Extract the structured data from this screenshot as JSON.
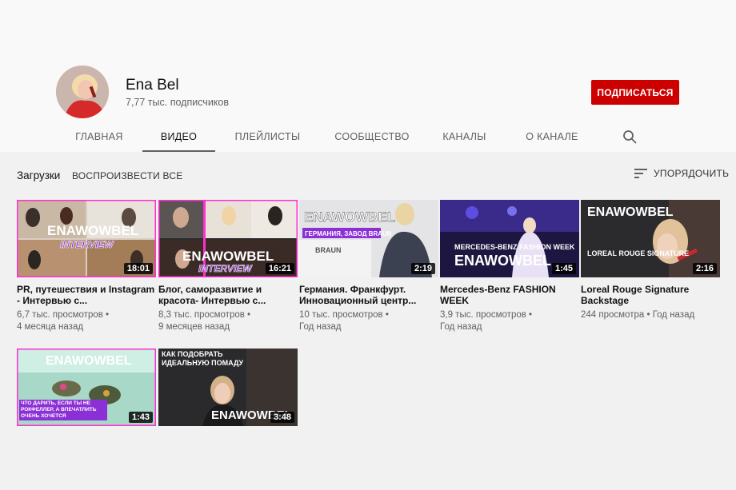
{
  "channel": {
    "name": "Ena Bel",
    "subscribers": "7,77 тыс. подписчиков",
    "subscribe_label": "ПОДПИСАТЬСЯ"
  },
  "tabs": [
    "ГЛАВНАЯ",
    "ВИДЕО",
    "ПЛЕЙЛИСТЫ",
    "СООБЩЕСТВО",
    "КАНАЛЫ",
    "О КАНАЛЕ"
  ],
  "section": {
    "title": "Загрузки",
    "play_all": "ВОСПРОИЗВЕСТИ ВСЕ",
    "sort_label": "УПОРЯДОЧИТЬ"
  },
  "videos": [
    {
      "title": "PR, путешествия и Instagram - Интервью с...",
      "views": "6,7 тыс. просмотров",
      "age": "4 месяца назад",
      "duration": "18:01",
      "thumb": {
        "logo": "ENAWOWBEL",
        "caption": "INTERVIEW",
        "top": ""
      }
    },
    {
      "title": "Блог, саморазвитие и красота- Интервью с...",
      "views": "8,3 тыс. просмотров",
      "age": "9 месяцев назад",
      "duration": "16:21",
      "thumb": {
        "logo": "ENAWOWBEL",
        "caption": "INTERVIEW",
        "top": ""
      }
    },
    {
      "title": "Германия. Франкфурт. Инновационный центр...",
      "views": "10 тыс. просмотров",
      "age": "Год назад",
      "duration": "2:19",
      "thumb": {
        "logo": "ENAWOWBEL",
        "caption": "ГЕРМАНИЯ, ЗАВОД BRAUN",
        "top": "BRAUN"
      }
    },
    {
      "title": "Mercedes-Benz FASHION WEEK",
      "views": "3,9 тыс. просмотров",
      "age": "Год назад",
      "duration": "1:45",
      "thumb": {
        "logo": "ENAWOWBEL",
        "caption": "MERCEDES-BENZ FASHION WEEK",
        "top": ""
      }
    },
    {
      "title": "Loreal Rouge Signature Backstage",
      "views": "244 просмотра",
      "age": "Год назад",
      "duration": "2:16",
      "thumb": {
        "logo": "ENAWOWBEL",
        "caption": "LOREAL ROUGE SIGNATURE",
        "top": ""
      }
    },
    {
      "title": "",
      "views": "",
      "age": "",
      "duration": "1:43",
      "thumb": {
        "logo": "ENAWOWBEL",
        "caption": "ЧТО ДАРИТЬ, ЕСЛИ ТЫ НЕ РОКФЕЛЛЕР, А ВПЕЧАТЛИТЬ ОЧЕНЬ ХОЧЕТСЯ",
        "top": ""
      }
    },
    {
      "title": "",
      "views": "",
      "age": "",
      "duration": "3:48",
      "thumb": {
        "logo": "ENAWOWBEL",
        "caption": "КАК ПОДОБРАТЬ ИДЕАЛЬНУЮ ПОМАДУ",
        "top": ""
      }
    }
  ],
  "colors": {
    "accent_red": "#cc0000",
    "logo_pink": "#ff2fd1",
    "caption_purple": "#8b2fd6"
  }
}
